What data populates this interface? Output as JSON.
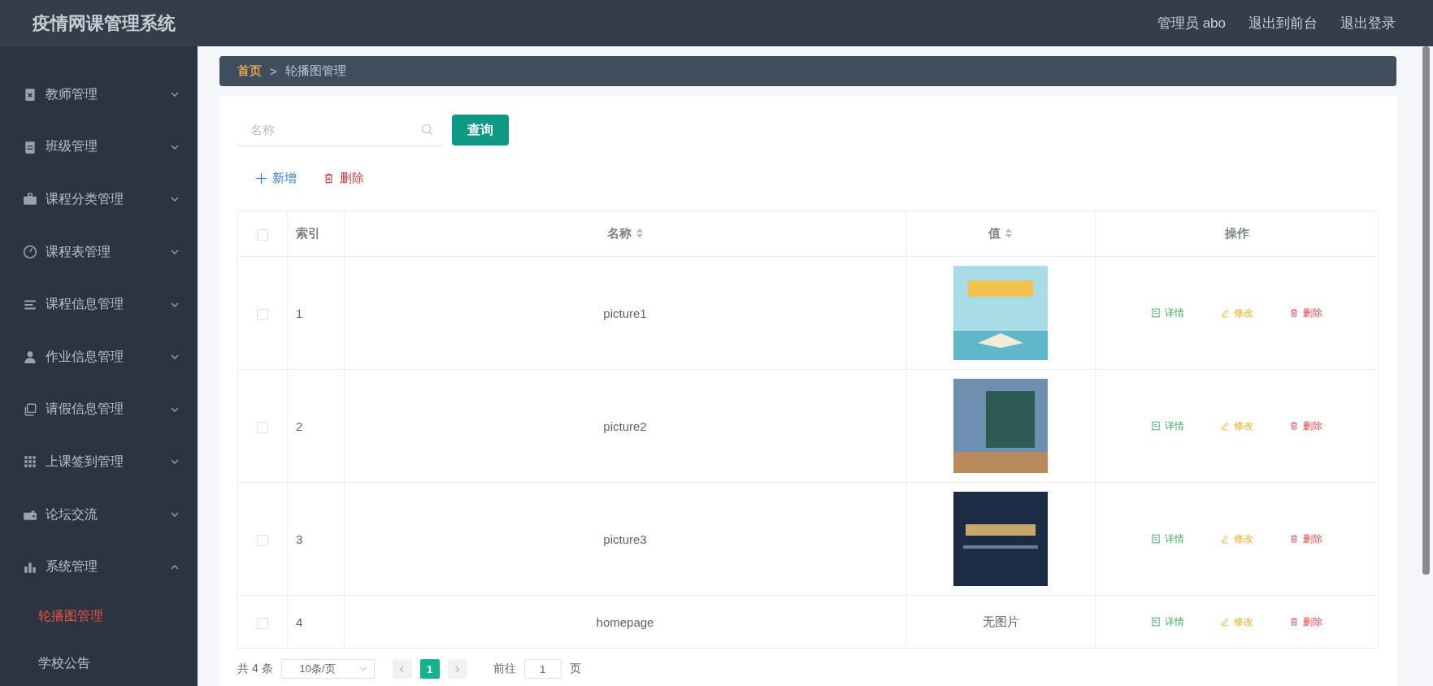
{
  "header": {
    "title": "疫情网课管理系统",
    "links": [
      "管理员 abo",
      "退出到前台",
      "退出登录"
    ]
  },
  "sidebar": {
    "items": [
      {
        "label": "教师管理",
        "expanded": false
      },
      {
        "label": "班级管理",
        "expanded": false
      },
      {
        "label": "课程分类管理",
        "expanded": false
      },
      {
        "label": "课程表管理",
        "expanded": false
      },
      {
        "label": "课程信息管理",
        "expanded": false
      },
      {
        "label": "作业信息管理",
        "expanded": false
      },
      {
        "label": "请假信息管理",
        "expanded": false
      },
      {
        "label": "上课签到管理",
        "expanded": false
      },
      {
        "label": "论坛交流",
        "expanded": false
      },
      {
        "label": "系统管理",
        "expanded": true,
        "children": [
          {
            "label": "轮播图管理",
            "selected": true
          },
          {
            "label": "学校公告",
            "selected": false
          }
        ]
      }
    ]
  },
  "breadcrumb_separator": ">",
  "breadcrumb": [
    {
      "label": "首页",
      "kind": "link"
    },
    {
      "label": "轮播图管理",
      "kind": "current"
    }
  ],
  "search": {
    "placeholder": "名称",
    "button": "查询"
  },
  "toolbar": [
    {
      "label": "新增",
      "kind": "add"
    },
    {
      "label": "删除",
      "kind": "delete"
    }
  ],
  "table": {
    "header_checked": false,
    "columns": [
      {
        "label": "索引",
        "sortable": false
      },
      {
        "label": "名称",
        "sortable": true
      },
      {
        "label": "值",
        "sortable": true
      },
      {
        "label": "操作",
        "sortable": false
      }
    ],
    "rows": [
      {
        "checked": false,
        "index": "1",
        "name": "picture1",
        "value": {
          "kind": "image"
        },
        "actions": [
          "详情",
          "修改",
          "删除"
        ]
      },
      {
        "checked": false,
        "index": "2",
        "name": "picture2",
        "value": {
          "kind": "image"
        },
        "actions": [
          "详情",
          "修改",
          "删除"
        ]
      },
      {
        "checked": false,
        "index": "3",
        "name": "picture3",
        "value": {
          "kind": "image"
        },
        "actions": [
          "详情",
          "修改",
          "删除"
        ]
      },
      {
        "checked": false,
        "index": "4",
        "name": "homepage",
        "value": {
          "kind": "text",
          "text": "无图片"
        },
        "actions": [
          "详情",
          "修改",
          "删除"
        ]
      }
    ]
  },
  "pagination": {
    "total": "共 4 条",
    "page_size": "10条/页",
    "pages": [
      {
        "label": "1",
        "selected": true
      }
    ],
    "goto_label": "前往",
    "goto_value": "1",
    "goto_suffix": "页"
  }
}
